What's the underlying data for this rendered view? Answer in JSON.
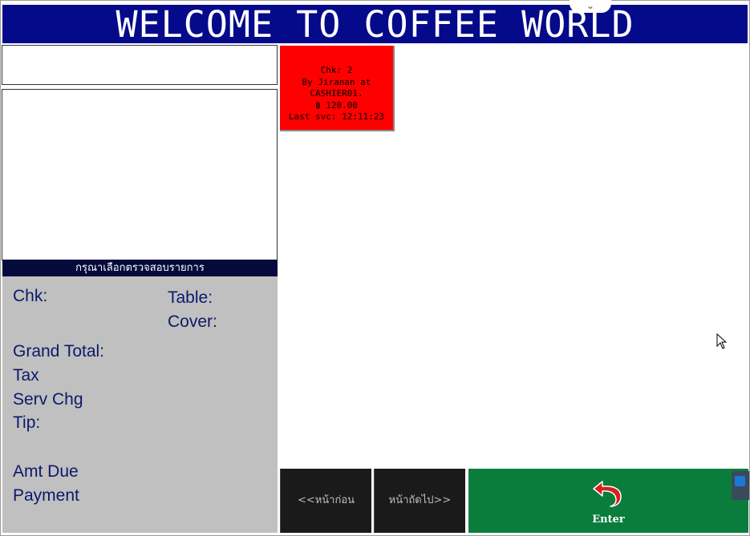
{
  "banner": {
    "title": "WELCOME TO COFFEE WORLD"
  },
  "order_panel": {
    "instruction": "กรุณาเลือกตรวจสอบรายการ",
    "labels": {
      "chk": "Chk:",
      "table": "Table:",
      "cover": "Cover:",
      "grand_total": "Grand Total:",
      "tax": "Tax",
      "serv_chg": "Serv Chg",
      "tip": "Tip:",
      "amt_due": "Amt Due",
      "payment": "Payment"
    }
  },
  "checks": [
    {
      "line1": "Chk: 2",
      "line2": "By Jiranan at",
      "line3": "CASHIER01.",
      "line4": "฿ 120.00",
      "line5": "Last svc: 12:11:23",
      "color": "#ff0000"
    }
  ],
  "buttons": {
    "prev": "<<หน้าก่อน",
    "next": "หน้าถัดไป>>",
    "enter": "Enter"
  },
  "colors": {
    "banner_bg": "#050a8a",
    "enter_bg": "#0a7d3c",
    "panel_bg": "#c0c0c0",
    "label_text": "#0a1a6a"
  },
  "icons": {
    "enter": "return-arrow-icon",
    "pulltab": "chevron-down-icon",
    "remote": "teamviewer-icon",
    "cursor": "mouse-pointer-icon"
  }
}
